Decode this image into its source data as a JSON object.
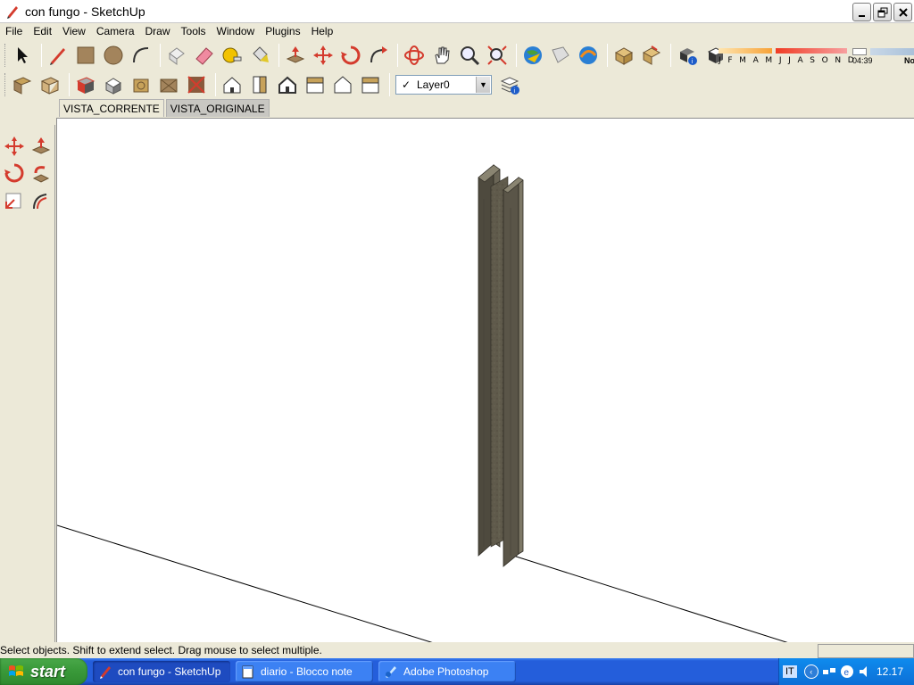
{
  "window": {
    "title": "con fungo - SketchUp"
  },
  "menu": [
    "File",
    "Edit",
    "View",
    "Camera",
    "Draw",
    "Tools",
    "Window",
    "Plugins",
    "Help"
  ],
  "toolbar1_icons": [
    "select-arrow-icon",
    "pencil-icon",
    "rectangle-icon",
    "circle-icon",
    "arc-icon",
    "make-component-icon",
    "eraser-icon",
    "tape-measure-icon",
    "paint-bucket-icon",
    "push-pull-icon",
    "move-icon",
    "rotate-icon",
    "follow-me-icon",
    "orbit-icon",
    "pan-hand-icon",
    "zoom-icon",
    "zoom-extents-icon",
    "google-earth-icon",
    "get-photo-texture-icon",
    "google-earth-toggle-icon",
    "get-models-icon",
    "share-model-icon",
    "component-info-icon",
    "shadow-cube-icon"
  ],
  "toolbar2_icons": [
    "xray-style-icon",
    "wireframe-style-icon",
    "hidden-line-icon",
    "shaded-style-icon",
    "shaded-textures-icon",
    "monochrome-style-icon",
    "iso-view-icon",
    "top-view-icon",
    "front-view-icon",
    "right-view-icon",
    "back-view-icon",
    "left-view-icon",
    "layer-manager-icon"
  ],
  "layer": {
    "current": "Layer0",
    "check": "✓"
  },
  "shadow": {
    "months": "J F M A M J J A S O N D",
    "time": "04:39",
    "noon": "No"
  },
  "scenes": [
    {
      "label": "VISTA_CORRENTE",
      "active": false
    },
    {
      "label": "VISTA_ORIGINALE",
      "active": true
    }
  ],
  "left_tools": [
    "move-icon",
    "push-pull-icon",
    "rotate-icon",
    "follow-me-icon",
    "offset-icon",
    "scale-icon"
  ],
  "status": {
    "text": "Select objects. Shift to extend select. Drag mouse to select multiple."
  },
  "taskbar": {
    "start": "start",
    "tasks": [
      {
        "label": "con fungo - SketchUp",
        "active": true
      },
      {
        "label": "diario - Blocco note",
        "active": false
      },
      {
        "label": "Adobe Photoshop",
        "active": false
      }
    ],
    "lang": "IT",
    "clock": "12.17"
  },
  "colors": {
    "beam_dark": "#4e4a3e",
    "beam_mid": "#6a6556",
    "beam_light": "#7d7866",
    "taskbar_blue": "#245edb",
    "start_green": "#3b9b3b"
  }
}
